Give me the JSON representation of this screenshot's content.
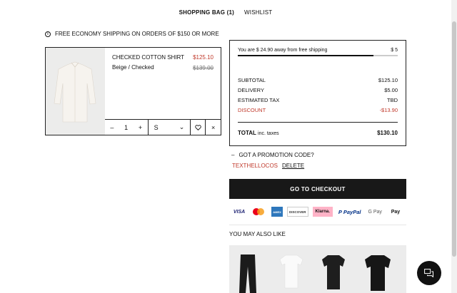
{
  "tabs": {
    "bag": "SHOPPING BAG (1)",
    "wishlist": "WISHLIST"
  },
  "shipping_notice": "FREE ECONOMY SHIPPING ON ORDERS OF $150 OR MORE",
  "cart_item": {
    "name": "CHECKED COTTON SHIRT",
    "variant": "Beige / Checked",
    "price": "$125.10",
    "original_price": "$139.00",
    "quantity": "1",
    "minus": "–",
    "plus": "+",
    "size": "S",
    "size_chevron": "⌄",
    "remove": "×"
  },
  "summary": {
    "free_shipping_text": "You are $ 24.90 away from free shipping",
    "free_shipping_amount": "$ 5",
    "free_shipping_progress": 0.85,
    "subtotal_label": "SUBTOTAL",
    "subtotal_value": "$125.10",
    "delivery_label": "DELIVERY",
    "delivery_value": "$5.00",
    "tax_label": "ESTIMATED TAX",
    "tax_value": "TBD",
    "discount_label": "DISCOUNT",
    "discount_value": "-$13.90",
    "total_label": "TOTAL",
    "total_note": "inc. taxes",
    "total_value": "$130.10"
  },
  "promo": {
    "toggle": "–",
    "label": "GOT A PROMOTION CODE?",
    "code": "TEXTHELLOCOS",
    "delete": "DELETE"
  },
  "checkout_label": "GO TO CHECKOUT",
  "payments": {
    "visa": "VISA",
    "amex": "AMEX",
    "discover": "DISCOVER",
    "klarna": "Klarna.",
    "paypal": "PayPal",
    "gpay": "G Pay",
    "apay": " Pay"
  },
  "recommendations_title": "YOU MAY ALSO LIKE",
  "colors": {
    "accent_red": "#c0392b",
    "dark": "#181818",
    "klarna_pink": "#ffb3c7"
  }
}
